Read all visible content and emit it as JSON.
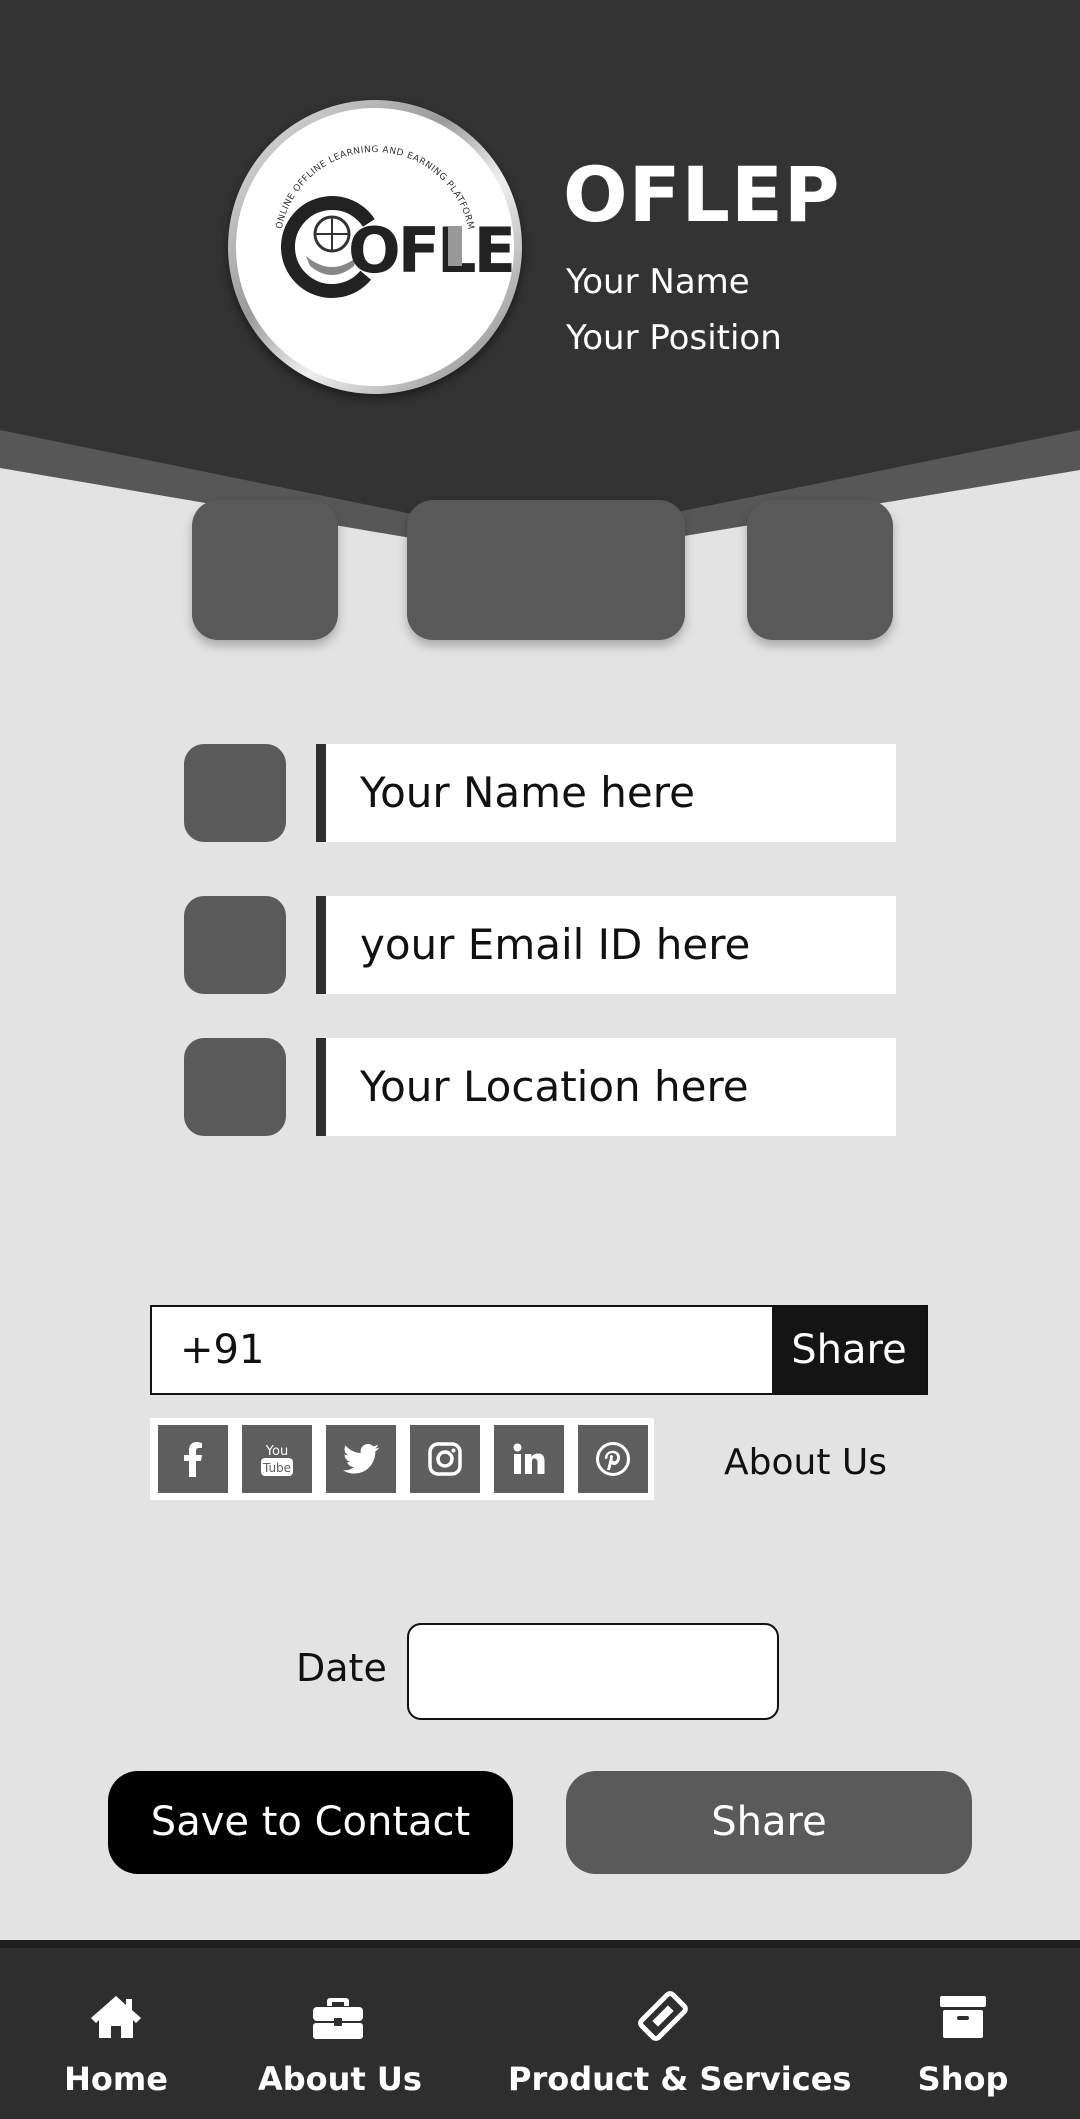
{
  "header": {
    "brand_title": "OFLEP",
    "name": "Your Name",
    "position": "Your Position",
    "logo": {
      "text": "OFLEP",
      "ring_text": "ONLINE OFFLINE LEARNING AND EARNING PLATFORM"
    }
  },
  "fields": [
    {
      "icon": "user-icon",
      "value": "Your Name here"
    },
    {
      "icon": "email-icon",
      "value": "your Email ID here"
    },
    {
      "icon": "location-icon",
      "value": "Your Location here"
    }
  ],
  "phone": {
    "value": "+91",
    "share_label": "Share"
  },
  "social": {
    "icons": [
      "facebook-icon",
      "youtube-icon",
      "twitter-icon",
      "instagram-icon",
      "linkedin-icon",
      "pinterest-icon"
    ],
    "about_label": "About Us"
  },
  "date": {
    "label": "Date",
    "value": ""
  },
  "actions": {
    "save_label": "Save to Contact",
    "share_label": "Share"
  },
  "nav": {
    "items": [
      {
        "label": "Home",
        "icon": "home-icon"
      },
      {
        "label": "About Us",
        "icon": "briefcase-icon"
      },
      {
        "label": "Product & Services",
        "icon": "ticket-icon"
      },
      {
        "label": "Shop",
        "icon": "archive-box-icon"
      }
    ]
  },
  "colors": {
    "header_bg": "#333333",
    "page_bg": "#e3e3e3",
    "tile": "#595959",
    "nav_bg": "#2e2e2e"
  }
}
